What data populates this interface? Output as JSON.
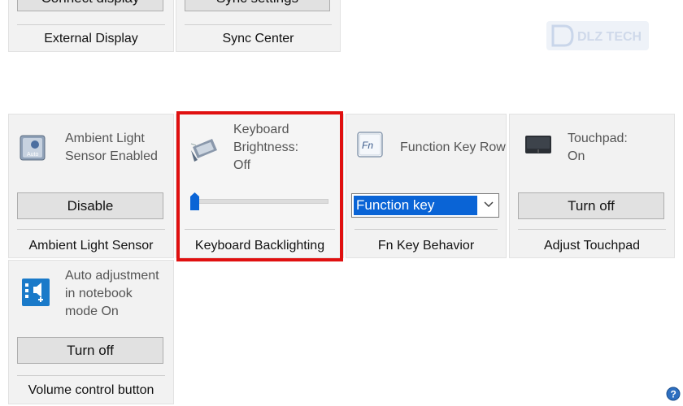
{
  "top_tiles": [
    {
      "button": "Connect display",
      "footer": "External Display"
    },
    {
      "button": "Sync settings",
      "footer": "Sync Center"
    }
  ],
  "tiles": [
    {
      "status": [
        "Ambient Light",
        "Sensor Enabled"
      ],
      "button": "Disable",
      "footer": "Ambient Light Sensor"
    },
    {
      "status": [
        "Keyboard",
        "Brightness:",
        "Off"
      ],
      "footer": "Keyboard Backlighting",
      "brightness_level": 0
    },
    {
      "status": [
        "Function Key Row"
      ],
      "select_value": "Function key",
      "footer": "Fn Key Behavior"
    },
    {
      "status": [
        "Touchpad:",
        "On"
      ],
      "button": "Turn off",
      "footer": "Adjust Touchpad"
    },
    {
      "status": [
        "Auto adjustment",
        "in notebook",
        "mode On"
      ],
      "button": "Turn off",
      "footer": "Volume control button"
    }
  ],
  "watermark": "DLZ TECH",
  "icons": {
    "ambient": "ambient-light-sensor-icon",
    "keyboard": "keyboard-backlight-icon",
    "fn": "function-key-icon",
    "touchpad": "touchpad-icon",
    "volume": "volume-control-icon",
    "help": "help-icon"
  },
  "colors": {
    "highlight": "#e01010",
    "accent": "#0a64d6"
  }
}
